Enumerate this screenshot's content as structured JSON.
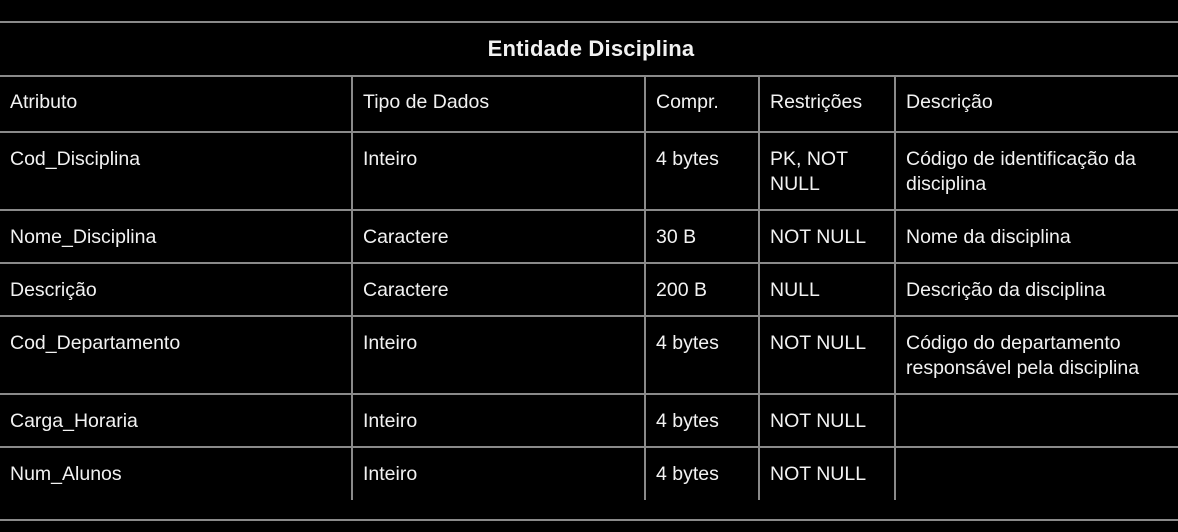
{
  "title": "Entidade Disciplina",
  "headers": [
    "Atributo",
    "Tipo de Dados",
    "Compr.",
    "Restrições",
    "Descrição"
  ],
  "rows": [
    [
      "Cod_Disciplina",
      "Inteiro",
      "4 bytes",
      "PK, NOT NULL",
      "Código de identificação da disciplina"
    ],
    [
      "Nome_Disciplina",
      "Caractere",
      "30 B",
      "NOT NULL",
      "Nome da disciplina"
    ],
    [
      "Descrição",
      "Caractere",
      "200 B",
      "NULL",
      "Descrição da disciplina"
    ],
    [
      "Cod_Departamento",
      "Inteiro",
      "4 bytes",
      "NOT NULL",
      "Código do departamento responsável pela disciplina"
    ],
    [
      "Carga_Horaria",
      "Inteiro",
      "4 bytes",
      "NOT NULL",
      ""
    ],
    [
      "Num_Alunos",
      "Inteiro",
      "4 bytes",
      "NOT NULL",
      ""
    ]
  ]
}
